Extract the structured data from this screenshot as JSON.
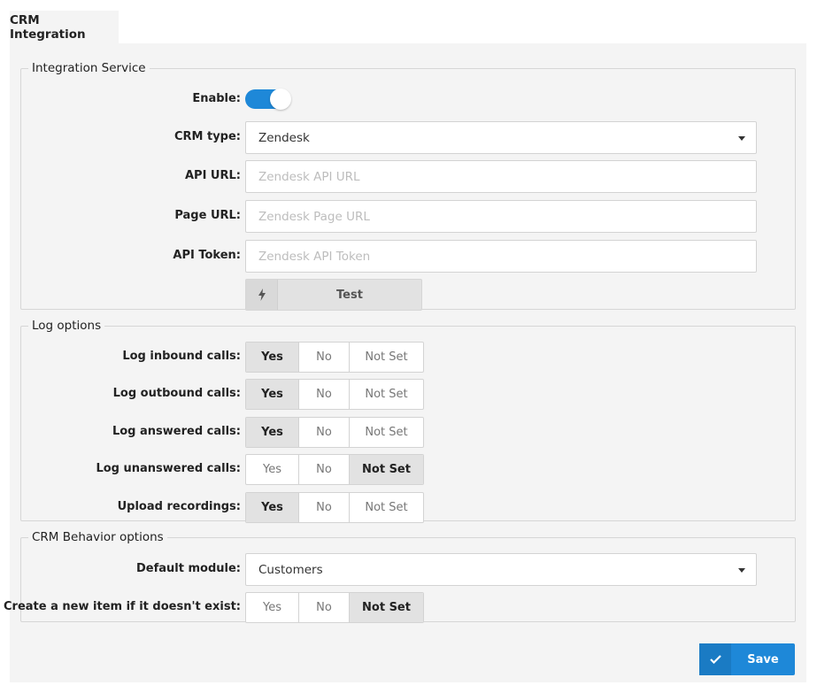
{
  "tab": {
    "label": "CRM Integration"
  },
  "integration": {
    "legend": "Integration Service",
    "enable_label": "Enable:",
    "enabled": true,
    "crm_type_label": "CRM type:",
    "crm_type_value": "Zendesk",
    "api_url_label": "API URL:",
    "api_url_placeholder": "Zendesk API URL",
    "page_url_label": "Page URL:",
    "page_url_placeholder": "Zendesk Page URL",
    "api_token_label": "API Token:",
    "api_token_placeholder": "Zendesk API Token",
    "test_button": "Test",
    "test_icon": "bolt-icon"
  },
  "log": {
    "legend": "Log options",
    "options": [
      "Yes",
      "No",
      "Not Set"
    ],
    "rows": [
      {
        "label": "Log inbound calls:",
        "selected": "Yes"
      },
      {
        "label": "Log outbound calls:",
        "selected": "Yes"
      },
      {
        "label": "Log answered calls:",
        "selected": "Yes"
      },
      {
        "label": "Log unanswered calls:",
        "selected": "Not Set"
      },
      {
        "label": "Upload recordings:",
        "selected": "Yes"
      }
    ]
  },
  "behavior": {
    "legend": "CRM Behavior options",
    "default_module_label": "Default module:",
    "default_module_value": "Customers",
    "create_label": "Create a new item if it doesn't exist:",
    "create_selected": "Not Set"
  },
  "save_button": {
    "label": "Save",
    "icon": "check-icon"
  },
  "colors": {
    "accent": "#1e88d8",
    "panel_bg": "#f4f4f4",
    "active_segment": "#e2e2e2"
  }
}
